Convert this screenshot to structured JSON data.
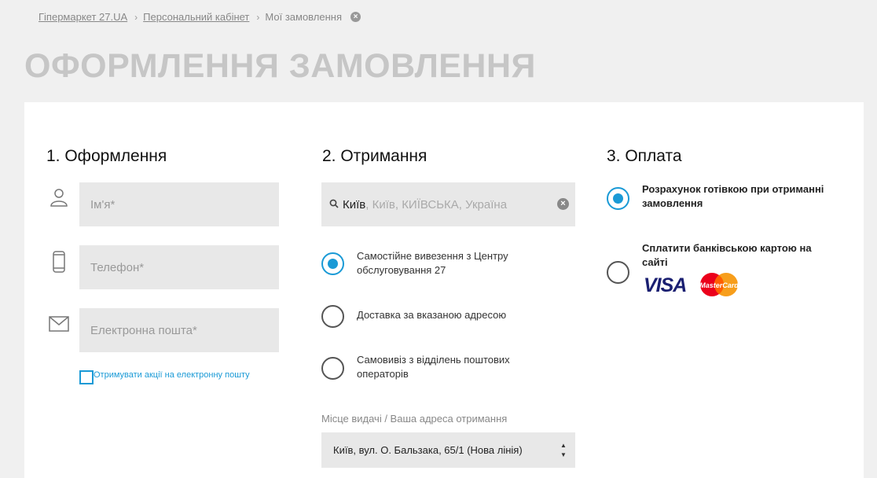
{
  "breadcrumb": {
    "items": [
      "Гіпермаркет 27.UA",
      "Персональний кабінет"
    ],
    "current": "Мої замовлення"
  },
  "page": {
    "title": "ОФОРМЛЕННЯ ЗАМОВЛЕННЯ"
  },
  "section1": {
    "title": "1. Оформлення",
    "name_placeholder": "Ім'я*",
    "phone_placeholder": "Телефон*",
    "email_placeholder": "Електронна пошта*",
    "subscribe_label": "Отримувати акції на електронну пошту",
    "subscribe_checked": false
  },
  "section2": {
    "title": "2. Отримання",
    "city_typed": "Київ",
    "city_suggestion": ", Київ, КИЇВСЬКА, Україна",
    "options": [
      {
        "label": "Самостійне вивезення з Центру обслуговування 27",
        "checked": true
      },
      {
        "label": "Доставка за вказаною адресою",
        "checked": false
      },
      {
        "label": "Самовивіз з відділень поштових операторів",
        "checked": false
      }
    ],
    "pickup_label": "Місце видачі / Ваша адреса отримання",
    "pickup_value": "Київ, вул. О. Бальзака, 65/1 (Нова лінія)"
  },
  "section3": {
    "title": "3. Оплата",
    "options": [
      {
        "label": "Розрахунок готівкою при отриманні замовлення",
        "checked": true
      },
      {
        "label": "Сплатити банківською картою на сайті",
        "checked": false
      }
    ],
    "card_logos": {
      "visa": "VISA",
      "mastercard": "MasterCard"
    }
  },
  "colors": {
    "accent": "#1a9ad6",
    "title_gray": "#c6c6c6",
    "field_bg": "#e8e8e8"
  },
  "icons": [
    "user-icon",
    "phone-icon",
    "mail-icon",
    "search-icon",
    "close-icon",
    "chevron-up-icon",
    "chevron-down-icon"
  ]
}
